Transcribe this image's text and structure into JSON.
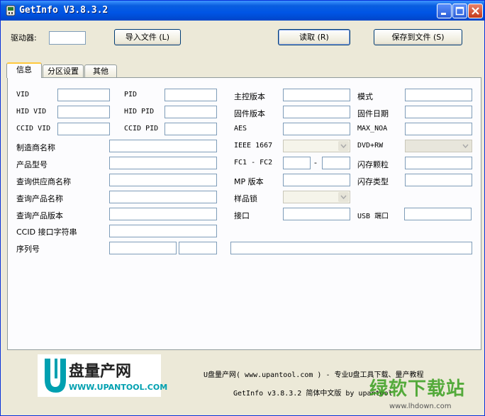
{
  "window": {
    "title": "GetInfo V3.8.3.2"
  },
  "toolbar": {
    "drive_label": "驱动器:",
    "drive_value": "",
    "import_label": "导入文件 (L)",
    "read_label": "读取 (R)",
    "save_label": "保存到文件 (S)"
  },
  "tabs": [
    {
      "label": "信息",
      "active": true
    },
    {
      "label": "分区设置",
      "active": false
    },
    {
      "label": "其他",
      "active": false
    }
  ],
  "fields": {
    "vid": "VID",
    "pid": "PID",
    "controller_version": "主控版本",
    "mode": "模式",
    "hid_vid": "HID VID",
    "hid_pid": "HID PID",
    "firmware_version": "固件版本",
    "firmware_date": "固件日期",
    "ccid_vid": "CCID VID",
    "ccid_pid": "CCID PID",
    "aes": "AES",
    "max_noa": "MAX_NOA",
    "manufacturer": "制造商名称",
    "ieee1667": "IEEE 1667",
    "dvd_rw": "DVD+RW",
    "product_model": "产品型号",
    "fc1_fc2": "FC1 - FC2",
    "fc_dash": "-",
    "flash_chip": "闪存颗粒",
    "query_vendor": "查询供应商名称",
    "mp_version": "MP 版本",
    "flash_type": "闪存类型",
    "query_product": "查询产品名称",
    "sample_lock": "样品锁",
    "query_version": "查询产品版本",
    "interface": "接口",
    "usb_port": "USB 端口",
    "ccid_interface_string": "CCID 接口字符串",
    "serial": "序列号"
  },
  "footer": {
    "logo_brand": "盘量产网",
    "logo_url": "WWW.UPANTOOL.COM",
    "line1": "U盘量产网( www.upantool.com ) - 专业U盘工具下载、量产教程",
    "line2": "GetInfo v3.8.3.2 简体中文版 by upantool",
    "watermark": "绿软下载站",
    "watermark_url": "www.lhdown.com"
  },
  "colors": {
    "titlebar": "#0055e5",
    "window_bg": "#ece9d8",
    "tab_accent": "#ffc83c",
    "logo_teal": "#00a0b0",
    "watermark_green": "#3aa020"
  }
}
